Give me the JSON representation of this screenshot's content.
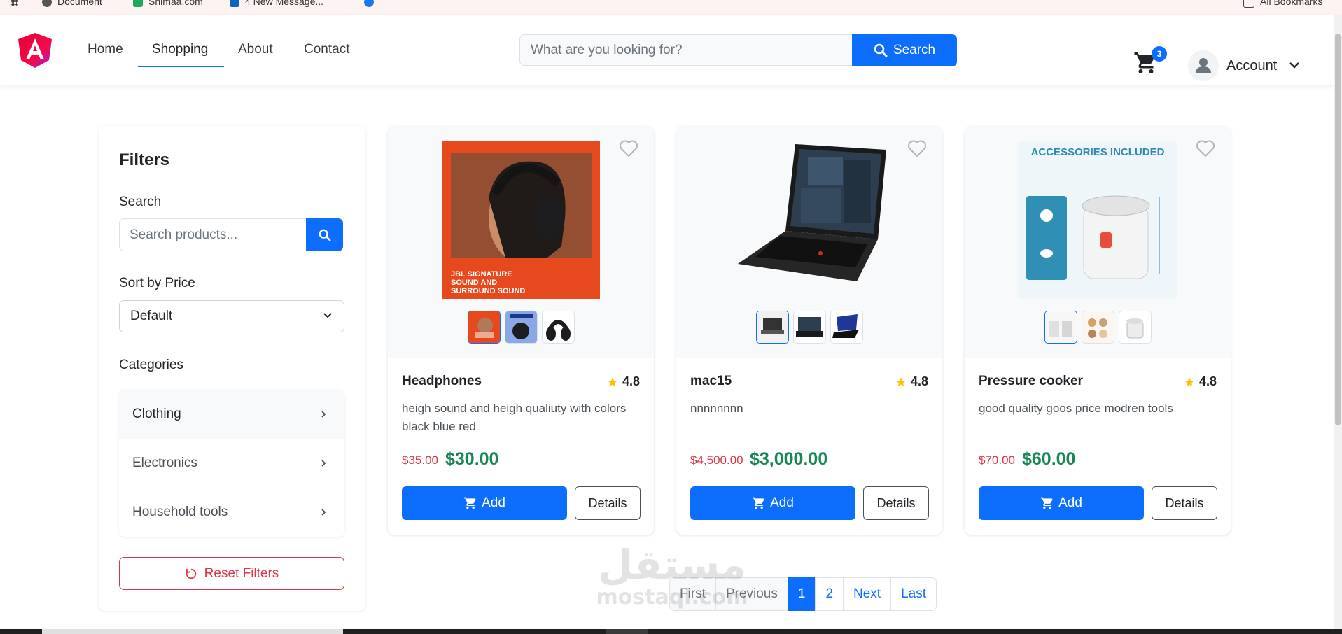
{
  "browser": {
    "bookmarks": [
      "Document",
      "Shimaa.com",
      "4 New Message..."
    ],
    "all_bookmarks": "All Bookmarks"
  },
  "nav": {
    "links": [
      "Home",
      "Shopping",
      "About",
      "Contact"
    ],
    "active": "Shopping",
    "search_placeholder": "What are you looking for?",
    "search_button": "Search",
    "cart_count": "3",
    "account_label": "Account"
  },
  "filters": {
    "title": "Filters",
    "search_label": "Search",
    "search_placeholder": "Search products...",
    "sort_label": "Sort by Price",
    "sort_value": "Default",
    "categories_label": "Categories",
    "categories": [
      "Clothing",
      "Electronics",
      "Household tools"
    ],
    "reset_label": "Reset Filters"
  },
  "products": [
    {
      "name": "Headphones",
      "rating": "4.8",
      "description": "heigh sound and heigh qualiuty with colors black blue red",
      "old_price": "$35.00",
      "price": "$30.00",
      "add_label": "Add",
      "details_label": "Details",
      "image_caption": "JBL SIGNATURE SOUND AND SURROUND SOUND"
    },
    {
      "name": "mac15",
      "rating": "4.8",
      "description": "nnnnnnnn",
      "old_price": "$4,500.00",
      "price": "$3,000.00",
      "add_label": "Add",
      "details_label": "Details"
    },
    {
      "name": "Pressure cooker",
      "rating": "4.8",
      "description": "good quality goos price modren tools",
      "old_price": "$70.00",
      "price": "$60.00",
      "add_label": "Add",
      "details_label": "Details",
      "image_caption": "ACCESSORIES INCLUDED"
    }
  ],
  "pagination": {
    "first": "First",
    "previous": "Previous",
    "pages": [
      "1",
      "2"
    ],
    "current": "1",
    "next": "Next",
    "last": "Last"
  },
  "watermark": {
    "arabic": "مستقل",
    "latin": "mostaql.com"
  },
  "colors": {
    "primary": "#0d6efd",
    "danger": "#dc3545",
    "success": "#198754",
    "star": "#ffc107"
  }
}
